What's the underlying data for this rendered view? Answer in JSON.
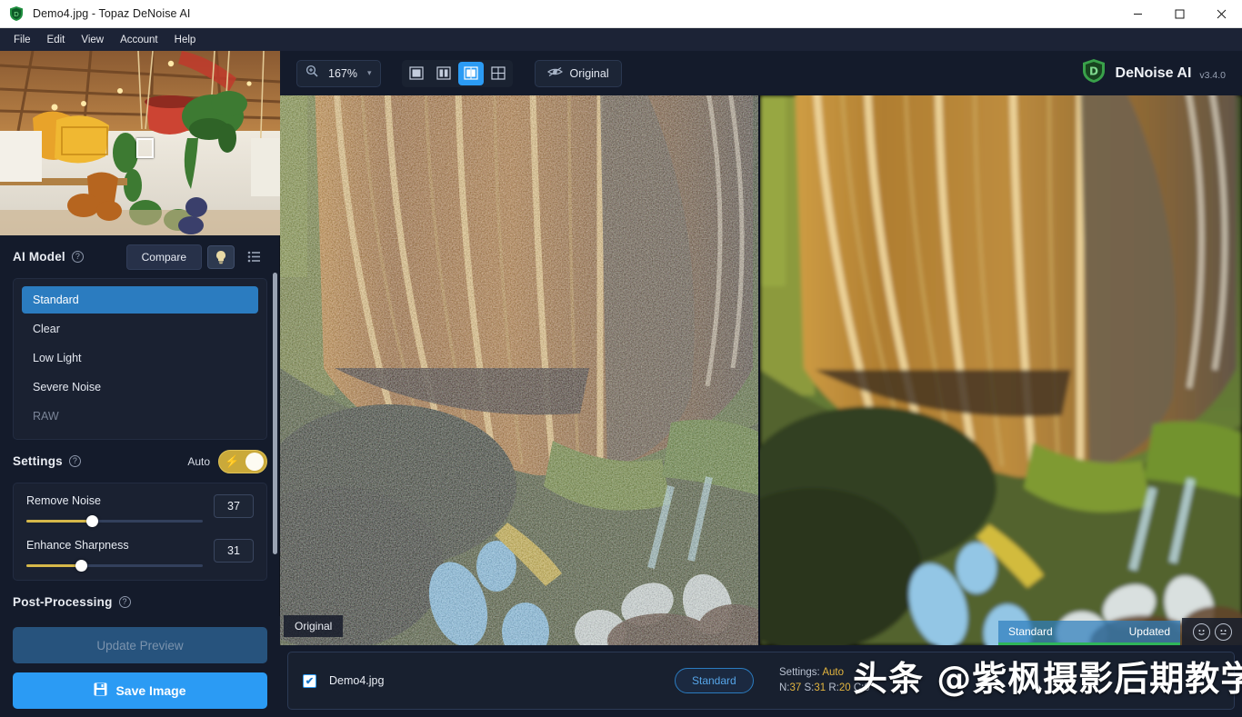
{
  "window": {
    "title": "Demo4.jpg - Topaz DeNoise AI",
    "app_icon": "topaz-shield-icon",
    "minimize": "—",
    "maximize": "☐",
    "close": "✕"
  },
  "menubar": {
    "items": [
      {
        "label": "File"
      },
      {
        "label": "Edit"
      },
      {
        "label": "View"
      },
      {
        "label": "Account"
      },
      {
        "label": "Help"
      }
    ]
  },
  "toolbar": {
    "zoom_icon": "zoom-in-icon",
    "zoom_value": "167%",
    "zoom_caret": "▾",
    "view_modes": [
      {
        "name": "single-view",
        "active": false
      },
      {
        "name": "split-view",
        "active": false
      },
      {
        "name": "side-by-side-view",
        "active": true
      },
      {
        "name": "quad-view",
        "active": false
      }
    ],
    "original_icon": "eye-off-icon",
    "original_label": "Original"
  },
  "brand": {
    "logo": "denoise-ai-logo",
    "name": "DeNoise AI",
    "version": "v3.4.0"
  },
  "sidebar": {
    "ai_model": {
      "title": "AI Model",
      "help": "?",
      "compare_label": "Compare",
      "bulb_icon": "lightbulb-icon",
      "list_icon": "list-icon",
      "models": [
        {
          "label": "Standard",
          "selected": true,
          "disabled": false
        },
        {
          "label": "Clear",
          "selected": false,
          "disabled": false
        },
        {
          "label": "Low Light",
          "selected": false,
          "disabled": false
        },
        {
          "label": "Severe Noise",
          "selected": false,
          "disabled": false
        },
        {
          "label": "RAW",
          "selected": false,
          "disabled": true
        }
      ]
    },
    "settings": {
      "title": "Settings",
      "help": "?",
      "auto_label": "Auto",
      "auto_on": true,
      "bolt_icon": "⚡",
      "sliders": [
        {
          "label": "Remove Noise",
          "value": "37",
          "percent": 37
        },
        {
          "label": "Enhance Sharpness",
          "value": "31",
          "percent": 31
        }
      ]
    },
    "post_processing": {
      "title": "Post-Processing",
      "help": "?"
    },
    "actions": {
      "update_preview_label": "Update Preview",
      "save_icon": "save-disk-icon",
      "save_label": "Save Image"
    }
  },
  "preview": {
    "original_tag": "Original",
    "badge_model": "Standard",
    "badge_status": "Updated",
    "feedback_icons": [
      {
        "name": "happy-face-icon",
        "glyph": "··"
      },
      {
        "name": "neutral-face-icon",
        "glyph": "··"
      }
    ]
  },
  "filmstrip": {
    "checkbox_checked": true,
    "checkbox_glyph": "✔",
    "file_name": "Demo4.jpg",
    "model_pill": "Standard",
    "settings_label": "Settings:",
    "settings_value": "Auto",
    "params": [
      {
        "key": "N:",
        "value": "37"
      },
      {
        "key": "S:",
        "value": "31"
      },
      {
        "key": "R:",
        "value": "20"
      },
      {
        "key": "C:",
        "value": "0"
      }
    ]
  },
  "watermark": {
    "text": "头条 @紫枫摄影后期教学"
  },
  "colors": {
    "accent_blue": "#2b9bf4",
    "panel_bg": "#141b2b",
    "amber": "#e3b53f",
    "green": "#2fb55a"
  }
}
